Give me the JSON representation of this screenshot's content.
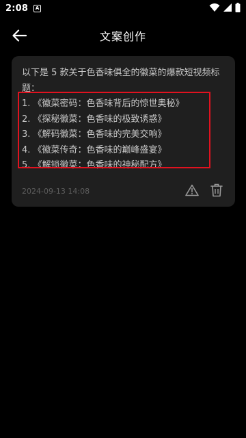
{
  "status_bar": {
    "time": "2:08",
    "notification_letter": "A"
  },
  "header": {
    "title": "文案创作"
  },
  "card": {
    "intro": "以下是 5 款关于色香味俱全的徽菜的爆款短视频标题：",
    "titles": [
      "1. 《徽菜密码：色香味背后的惊世奥秘》",
      "2. 《探秘徽菜：色香味的极致诱惑》",
      "3. 《解码徽菜：色香味的完美交响》",
      "4. 《徽菜传奇：色香味的巅峰盛宴》",
      "5. 《解锁徽菜：色香味的神秘配方》"
    ],
    "timestamp": "2024-09-13 14:08"
  },
  "icons": {
    "back": "arrow-left-icon",
    "report": "warning-triangle-icon",
    "delete": "trash-icon"
  },
  "colors": {
    "background": "#000000",
    "card": "#1f1f1f",
    "highlight": "#e0121f"
  }
}
